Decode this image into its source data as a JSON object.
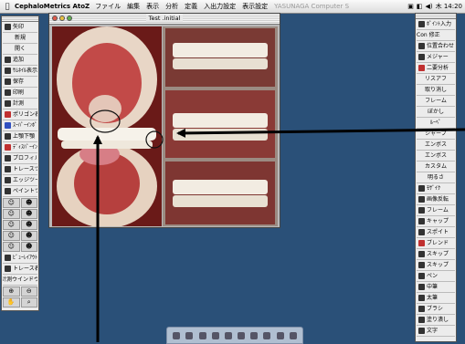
{
  "menubar": {
    "app": "CephaloMetrics AtoZ",
    "menus": [
      "ファイル",
      "編集",
      "表示",
      "分析",
      "定義",
      "入出力設定",
      "表示設定"
    ],
    "watermark": "YASUNAGA Computer S",
    "icons": [
      "monitor-icon",
      "display-icon",
      "volume-icon",
      "clock-icon"
    ],
    "clock": "木 14:20"
  },
  "window": {
    "title": "Test .initial"
  },
  "left_toolbar": {
    "top": "矢印",
    "items": [
      "新規",
      "開く",
      "追加",
      "ｻﾑﾈｲﾙ表示",
      "保存",
      "印刷",
      "計測",
      "ポリゴン表",
      "ｽｰﾊﾟｰｲﾝﾎﾟｽﾞ",
      "上顎下顎",
      "ﾃﾞｨｽﾊﾟｰｲﾝﾎﾟｽﾞ",
      "プロフィル",
      "トレースツール",
      "エッジツール",
      "ペイントツール"
    ],
    "icon_rows": [
      [
        "☺",
        "☻"
      ],
      [
        "☺",
        "☻"
      ],
      [
        "☺",
        "☻"
      ],
      [
        "☺",
        "☻"
      ],
      [
        "☺",
        "☻"
      ]
    ],
    "bottom": [
      "ﾋﾞｭｰﾚｲｱｳﾄ",
      "トレース表示",
      "計測ウインドウ"
    ],
    "tools": [
      [
        "⊕",
        "⊖"
      ],
      [
        "✋",
        "⌕"
      ]
    ]
  },
  "right_toolbar": {
    "items": [
      "ﾎﾟｲﾝﾄ入力",
      "Con 修正",
      "位置合わせ",
      "メジャー",
      "二要分析",
      "リスアフ",
      "取り消し",
      "フレーム",
      "ぼかし",
      "ﾙｰﾍﾟ",
      "シャープ",
      "エンボス",
      "エンボス",
      "カスタム",
      "明るさ",
      "ﾓｻﾞｲｸ",
      "画像反転",
      "フレーム",
      "キャップ",
      "スポイト",
      "ブレンド",
      "スキップ",
      "スキップ",
      "ペン",
      "中筆",
      "太筆",
      "ブラシ",
      "塗り潰し",
      "文字"
    ]
  }
}
